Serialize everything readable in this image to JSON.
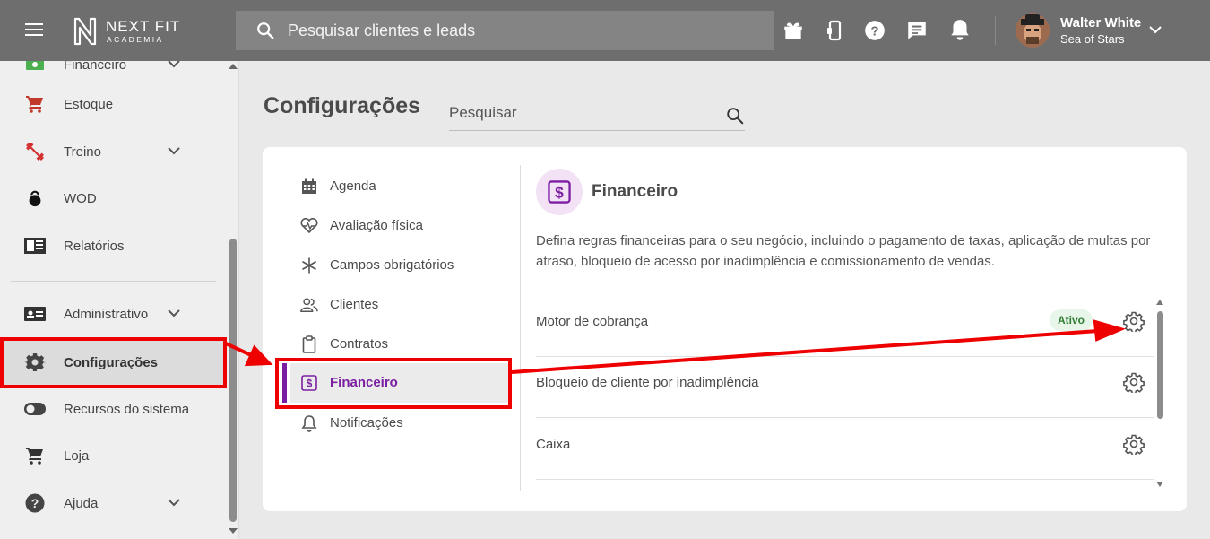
{
  "header": {
    "logo_word": "NEXT FIT",
    "logo_sub": "ACADEMIA",
    "search_placeholder": "Pesquisar clientes e leads",
    "icons": [
      "gift-icon",
      "mobile-device-icon",
      "help-icon",
      "chat-icon",
      "notification-bell-icon"
    ],
    "user_name": "Walter White",
    "user_org": "Sea of Stars"
  },
  "sidebar": {
    "items": [
      {
        "label": "Financeiro",
        "icon": "money-icon",
        "chevron": true
      },
      {
        "label": "Estoque",
        "icon": "cart-icon",
        "chevron": false
      },
      {
        "label": "Treino",
        "icon": "dumbbell-icon",
        "chevron": true
      },
      {
        "label": "WOD",
        "icon": "kettlebell-icon",
        "chevron": false
      },
      {
        "label": "Relatórios",
        "icon": "report-icon",
        "chevron": false
      },
      {
        "label": "Administrativo",
        "icon": "id-card-icon",
        "chevron": true
      },
      {
        "label": "Configurações",
        "icon": "settings-gear-icon",
        "chevron": false,
        "active": true
      },
      {
        "label": "Recursos do sistema",
        "icon": "toggle-icon",
        "chevron": false
      },
      {
        "label": "Loja",
        "icon": "cart-icon",
        "chevron": false
      },
      {
        "label": "Ajuda",
        "icon": "help-icon",
        "chevron": true
      }
    ]
  },
  "main": {
    "title": "Configurações",
    "search_placeholder": "Pesquisar",
    "categories": [
      {
        "label": "Agenda",
        "icon": "calendar-icon"
      },
      {
        "label": "Avaliação física",
        "icon": "heart-pulse-icon"
      },
      {
        "label": "Campos obrigatórios",
        "icon": "asterisk-icon"
      },
      {
        "label": "Clientes",
        "icon": "users-icon"
      },
      {
        "label": "Contratos",
        "icon": "clipboard-icon"
      },
      {
        "label": "Financeiro",
        "icon": "dollar-square-icon",
        "active": true
      },
      {
        "label": "Notificações",
        "icon": "bell-icon"
      }
    ],
    "section": {
      "title": "Financeiro",
      "description": "Defina regras financeiras para o seu negócio, incluindo o pagamento de taxas, aplicação de multas por atraso, bloqueio de acesso por inadimplência e comissionamento de vendas.",
      "settings": [
        {
          "label": "Motor de cobrança",
          "badge": "Ativo"
        },
        {
          "label": "Bloqueio de cliente por inadimplência",
          "badge": ""
        },
        {
          "label": "Caixa",
          "badge": ""
        }
      ]
    }
  },
  "colors": {
    "header_bg": "#6e6e6e",
    "accent_purple": "#7b1fa2",
    "annotation_red": "#ee0000",
    "badge_green": "#2e7d32"
  }
}
